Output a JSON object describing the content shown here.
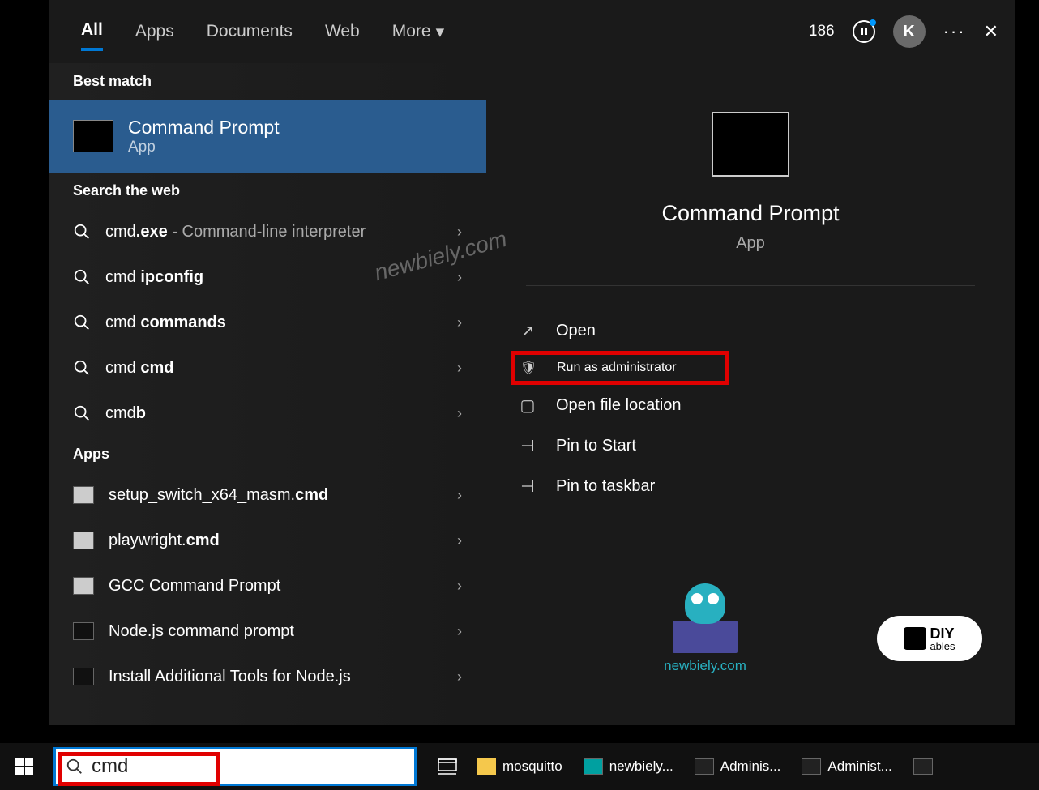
{
  "header": {
    "tabs": {
      "all": "All",
      "apps": "Apps",
      "documents": "Documents",
      "web": "Web",
      "more": "More"
    },
    "points": "186",
    "avatar_letter": "K"
  },
  "left": {
    "best_match_label": "Best match",
    "best_match": {
      "title": "Command Prompt",
      "subtitle": "App"
    },
    "search_web_label": "Search the web",
    "web_results": [
      {
        "prefix": "cmd",
        "bold": ".exe",
        "suffix": " - Command-line interpreter"
      },
      {
        "prefix": "cmd ",
        "bold": "ipconfig",
        "suffix": ""
      },
      {
        "prefix": "cmd ",
        "bold": "commands",
        "suffix": ""
      },
      {
        "prefix": "cmd ",
        "bold": "cmd",
        "suffix": ""
      },
      {
        "prefix": "cmd",
        "bold": "b",
        "suffix": ""
      }
    ],
    "apps_label": "Apps",
    "app_results": [
      {
        "pre": "setup_switch_x64_masm.",
        "bold": "cmd"
      },
      {
        "pre": "playwright.",
        "bold": "cmd"
      },
      {
        "pre": "GCC Command Prompt",
        "bold": ""
      },
      {
        "pre": "Node.js command prompt",
        "bold": ""
      },
      {
        "pre": "Install Additional Tools for Node.js",
        "bold": ""
      }
    ]
  },
  "detail": {
    "title": "Command Prompt",
    "subtitle": "App",
    "actions": {
      "open": "Open",
      "run_admin": "Run as administrator",
      "open_loc": "Open file location",
      "pin_start": "Pin to Start",
      "pin_taskbar": "Pin to taskbar"
    }
  },
  "taskbar": {
    "search_value": "cmd",
    "items": [
      {
        "label": "mosquitto",
        "type": "folder"
      },
      {
        "label": "newbiely...",
        "type": "ard"
      },
      {
        "label": "Adminis...",
        "type": "cmd"
      },
      {
        "label": "Administ...",
        "type": "cmd"
      }
    ]
  },
  "watermarks": {
    "domain": "newbiely.com",
    "diy_top": "DIY",
    "diy_bottom": "ables"
  }
}
